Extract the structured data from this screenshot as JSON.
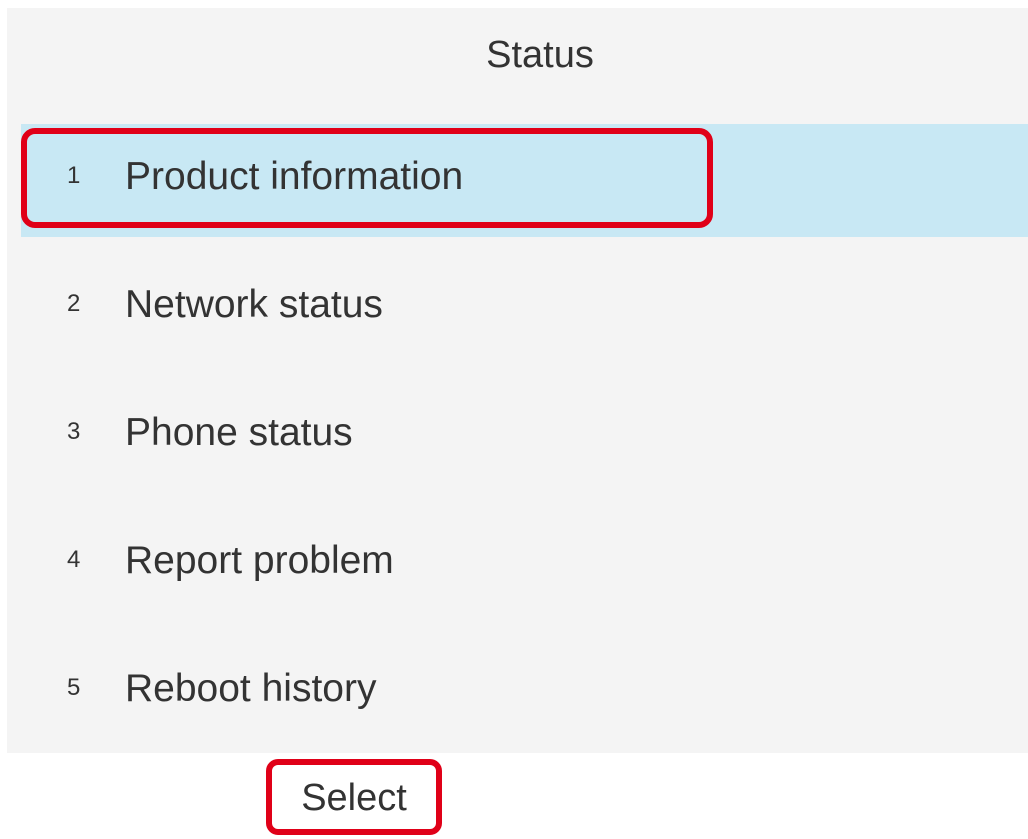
{
  "header": {
    "title": "Status"
  },
  "menu": {
    "selected_index": 0,
    "items": [
      {
        "number": "1",
        "label": "Product information"
      },
      {
        "number": "2",
        "label": "Network status"
      },
      {
        "number": "3",
        "label": "Phone status"
      },
      {
        "number": "4",
        "label": "Report problem"
      },
      {
        "number": "5",
        "label": "Reboot history"
      }
    ]
  },
  "softkeys": {
    "select_label": "Select"
  },
  "colors": {
    "background": "#f4f4f4",
    "selection": "#c8e8f4",
    "highlight_border": "#e00018",
    "text": "#333333"
  }
}
